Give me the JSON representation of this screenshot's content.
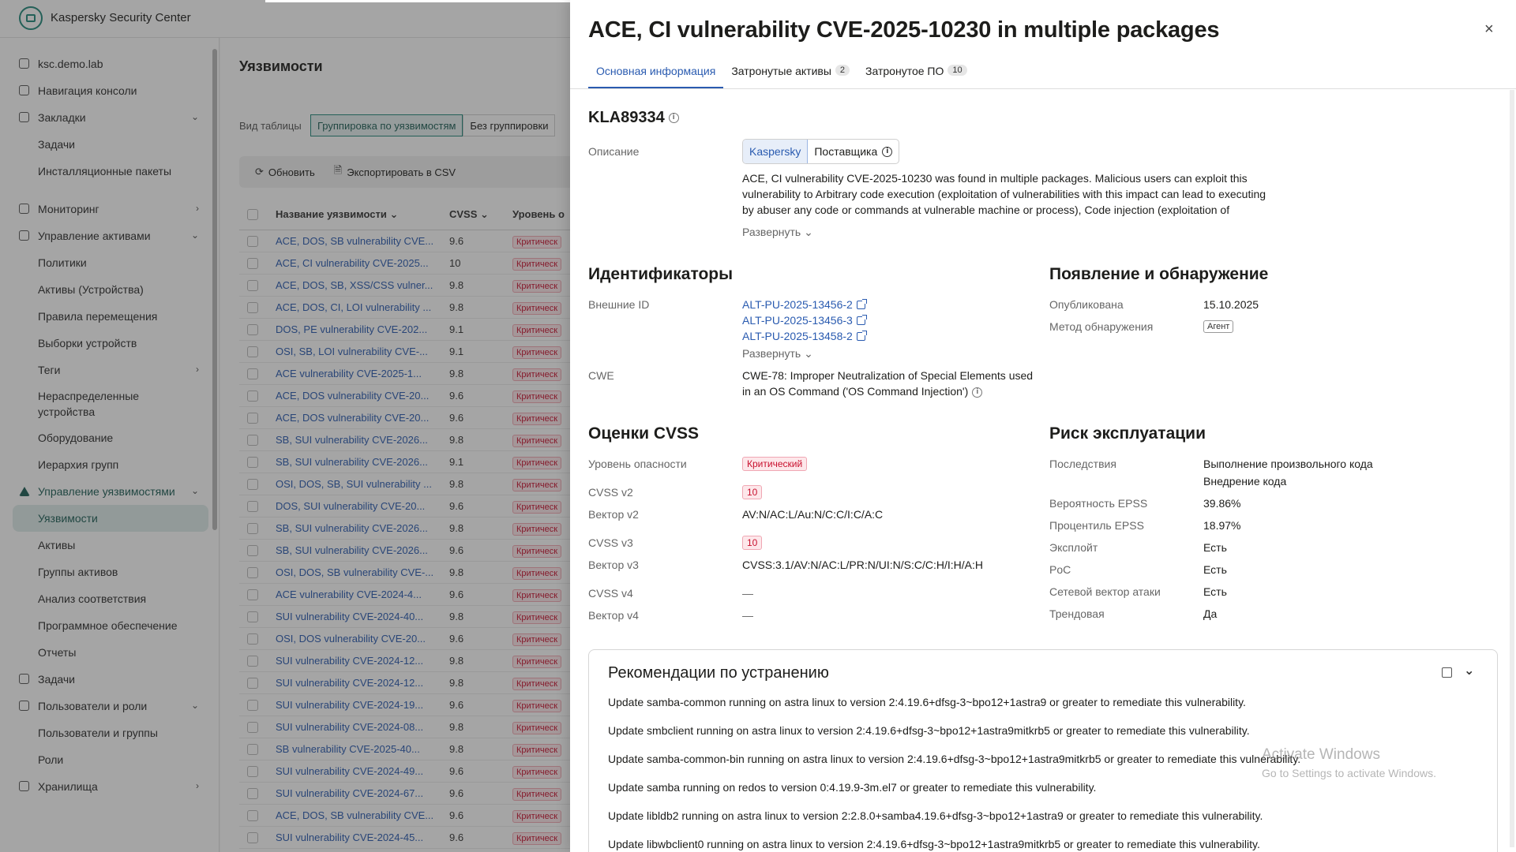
{
  "app": {
    "product": "Kaspersky Security Center"
  },
  "sidebar": {
    "items": [
      {
        "label": "ksc.demo.lab",
        "kind": "top"
      },
      {
        "label": "Навигация консоли",
        "kind": "top"
      },
      {
        "label": "Закладки",
        "kind": "top",
        "chevron": "down"
      },
      {
        "label": "Задачи",
        "kind": "sub"
      },
      {
        "label": "Инсталляционные пакеты",
        "kind": "sub"
      },
      {
        "label": "Мониторинг",
        "kind": "top",
        "chevron": "right"
      },
      {
        "label": "Управление активами",
        "kind": "top",
        "chevron": "down"
      },
      {
        "label": "Политики",
        "kind": "sub"
      },
      {
        "label": "Активы (Устройства)",
        "kind": "sub"
      },
      {
        "label": "Правила перемещения",
        "kind": "sub"
      },
      {
        "label": "Выборки устройств",
        "kind": "sub"
      },
      {
        "label": "Теги",
        "kind": "sub",
        "chevron": "right"
      },
      {
        "label": "Нераспределенные устройства",
        "kind": "sub"
      },
      {
        "label": "Оборудование",
        "kind": "sub"
      },
      {
        "label": "Иерархия групп",
        "kind": "sub"
      },
      {
        "label": "Управление уязвимостями",
        "kind": "top",
        "chevron": "down"
      },
      {
        "label": "Уязвимости",
        "kind": "sub",
        "active": true
      },
      {
        "label": "Активы",
        "kind": "sub"
      },
      {
        "label": "Группы активов",
        "kind": "sub"
      },
      {
        "label": "Анализ соответствия",
        "kind": "sub"
      },
      {
        "label": "Программное обеспечение",
        "kind": "sub"
      },
      {
        "label": "Отчеты",
        "kind": "sub"
      },
      {
        "label": "Задачи",
        "kind": "top"
      },
      {
        "label": "Пользователи и роли",
        "kind": "top",
        "chevron": "down"
      },
      {
        "label": "Пользователи и группы",
        "kind": "sub"
      },
      {
        "label": "Роли",
        "kind": "sub"
      },
      {
        "label": "Хранилища",
        "kind": "top",
        "chevron": "right"
      }
    ],
    "collapse_icon": "«"
  },
  "main": {
    "title": "Уязвимости",
    "view_label": "Вид таблицы",
    "view_options": [
      "Группировка по уязвимостям",
      "Без группировки"
    ],
    "toolbar": {
      "refresh": "Обновить",
      "export": "Экспортировать в CSV"
    },
    "columns": {
      "name": "Название уязвимости",
      "cvss": "CVSS",
      "severity": "Уровень о"
    },
    "severity_badge": "Критическ",
    "rows": [
      {
        "name": "ACE, DOS, SB vulnerability CVE...",
        "cvss": "9.6"
      },
      {
        "name": "ACE, CI vulnerability CVE-2025...",
        "cvss": "10"
      },
      {
        "name": "ACE, DOS, SB, XSS/CSS vulner...",
        "cvss": "9.8"
      },
      {
        "name": "ACE, DOS, CI, LOI vulnerability ...",
        "cvss": "9.8"
      },
      {
        "name": "DOS, PE vulnerability CVE-202...",
        "cvss": "9.1"
      },
      {
        "name": "OSI, SB, LOI vulnerability CVE-...",
        "cvss": "9.1"
      },
      {
        "name": "ACE vulnerability CVE-2025-1...",
        "cvss": "9.8"
      },
      {
        "name": "ACE, DOS vulnerability CVE-20...",
        "cvss": "9.6"
      },
      {
        "name": "ACE, DOS vulnerability CVE-20...",
        "cvss": "9.6"
      },
      {
        "name": "SB, SUI vulnerability CVE-2026...",
        "cvss": "9.8"
      },
      {
        "name": "SB, SUI vulnerability CVE-2026...",
        "cvss": "9.1"
      },
      {
        "name": "OSI, DOS, SB, SUI vulnerability ...",
        "cvss": "9.8"
      },
      {
        "name": "DOS, SUI vulnerability CVE-20...",
        "cvss": "9.6"
      },
      {
        "name": "SB, SUI vulnerability CVE-2026...",
        "cvss": "9.8"
      },
      {
        "name": "SB, SUI vulnerability CVE-2026...",
        "cvss": "9.6"
      },
      {
        "name": "OSI, DOS, SB vulnerability CVE-...",
        "cvss": "9.8"
      },
      {
        "name": "ACE vulnerability CVE-2024-4...",
        "cvss": "9.6"
      },
      {
        "name": "SUI vulnerability CVE-2024-40...",
        "cvss": "9.8"
      },
      {
        "name": "OSI, DOS vulnerability CVE-20...",
        "cvss": "9.6"
      },
      {
        "name": "SUI vulnerability CVE-2024-12...",
        "cvss": "9.8"
      },
      {
        "name": "SUI vulnerability CVE-2024-12...",
        "cvss": "9.8"
      },
      {
        "name": "SUI vulnerability CVE-2024-19...",
        "cvss": "9.6"
      },
      {
        "name": "SUI vulnerability CVE-2024-08...",
        "cvss": "9.8"
      },
      {
        "name": "SB vulnerability CVE-2025-40...",
        "cvss": "9.8"
      },
      {
        "name": "SUI vulnerability CVE-2024-49...",
        "cvss": "9.6"
      },
      {
        "name": "SUI vulnerability CVE-2024-67...",
        "cvss": "9.6"
      },
      {
        "name": "ACE, DOS, SB vulnerability CVE...",
        "cvss": "9.6"
      },
      {
        "name": "SUI vulnerability CVE-2024-45...",
        "cvss": "9.6"
      }
    ]
  },
  "drawer": {
    "title": "ACE, CI vulnerability CVE-2025-10230 in multiple packages",
    "close_icon": "×",
    "tabs": [
      {
        "label": "Основная информация",
        "count": ""
      },
      {
        "label": "Затронутые активы",
        "count": "2"
      },
      {
        "label": "Затронутое ПО",
        "count": "10"
      }
    ],
    "id": "KLA89334",
    "description_label": "Описание",
    "source_options": [
      "Kaspersky",
      "Поставщика"
    ],
    "description_lines": [
      "ACE, CI vulnerability CVE-2025-10230 was found in multiple packages. Malicious users can exploit this",
      "vulnerability to Arbitrary code execution (exploitation of vulnerabilities with this impact can lead to executing",
      "by abuser any code or commands at vulnerable machine or process), Code injection (exploitation of"
    ],
    "expand_label": "Развернуть",
    "identifiers": {
      "heading": "Идентификаторы",
      "external_label": "Внешние ID",
      "external_ids": [
        "ALT-PU-2025-13456-2",
        "ALT-PU-2025-13456-3",
        "ALT-PU-2025-13458-2"
      ],
      "cwe_label": "CWE",
      "cwe_lines": [
        "CWE-78: Improper Neutralization of Special Elements used",
        "in an OS Command ('OS Command Injection')"
      ]
    },
    "discovery": {
      "heading": "Появление и обнаружение",
      "published_label": "Опубликована",
      "published": "15.10.2025",
      "method_label": "Метод обнаружения",
      "method": "Агент"
    },
    "cvss": {
      "heading": "Оценки CVSS",
      "severity_label": "Уровень опасности",
      "severity": "Критический",
      "v2_label": "CVSS v2",
      "v2": "10",
      "v2_vector_label": "Вектор v2",
      "v2_vector": "AV:N/AC:L/Au:N/C:C/I:C/A:C",
      "v3_label": "CVSS v3",
      "v3": "10",
      "v3_vector_label": "Вектор v3",
      "v3_vector": "CVSS:3.1/AV:N/AC:L/PR:N/UI:N/S:C/C:H/I:H/A:H",
      "v4_label": "CVSS v4",
      "v4": "—",
      "v4_vector_label": "Вектор v4",
      "v4_vector": "—"
    },
    "risk": {
      "heading": "Риск эксплуатации",
      "consequences_label": "Последствия",
      "consequences": [
        "Выполнение произвольного кода",
        "Внедрение кода"
      ],
      "epss_prob_label": "Вероятность EPSS",
      "epss_prob": "39.86%",
      "epss_pct_label": "Процентиль EPSS",
      "epss_pct": "18.97%",
      "exploit_label": "Эксплойт",
      "exploit": "Есть",
      "poc_label": "PoC",
      "poc": "Есть",
      "network_label": "Сетевой вектор атаки",
      "network": "Есть",
      "trending_label": "Трендовая",
      "trending": "Да"
    },
    "remediation": {
      "heading": "Рекомендации по устранению",
      "lines": [
        "Update samba-common running on astra linux to version 2:4.19.6+dfsg-3~bpo12+1astra9 or greater to remediate this vulnerability.",
        "Update smbclient running on astra linux to version 2:4.19.6+dfsg-3~bpo12+1astra9mitkrb5 or greater to remediate this vulnerability.",
        "Update samba-common-bin running on astra linux to version 2:4.19.6+dfsg-3~bpo12+1astra9mitkrb5 or greater to remediate this vulnerability.",
        "Update samba running on redos to version 0:4.19.9-3m.el7 or greater to remediate this vulnerability.",
        "Update libldb2 running on astra linux to version 2:2.8.0+samba4.19.6+dfsg-3~bpo12+1astra9 or greater to remediate this vulnerability.",
        "Update libwbclient0 running on astra linux to version 2:4.19.6+dfsg-3~bpo12+1astra9mitkrb5 or greater to remediate this vulnerability."
      ]
    }
  },
  "watermark": {
    "title": "Activate Windows",
    "subtitle": "Go to Settings to activate Windows."
  },
  "colors": {
    "accent": "#2a5bb0",
    "brand": "#21887b",
    "critical": "#c8102e"
  }
}
